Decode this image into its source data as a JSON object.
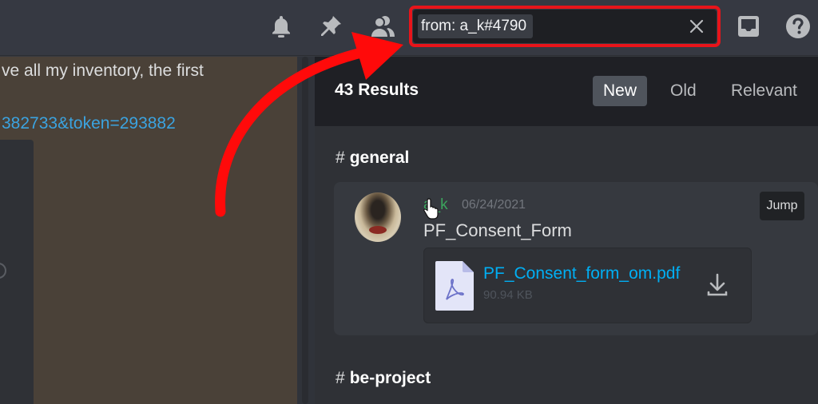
{
  "header": {
    "icons": [
      "bell-icon",
      "pin-icon",
      "members-icon",
      "inbox-icon",
      "help-icon"
    ],
    "search": {
      "query_token": "from: a_k#4790",
      "highlight_color": "#e8141a"
    }
  },
  "chat": {
    "message_text": "ve all my inventory, the first",
    "link_text": "382733&token=293882"
  },
  "results": {
    "count_label": "43 Results",
    "sort_tabs": [
      {
        "label": "New",
        "active": true
      },
      {
        "label": "Old",
        "active": false
      },
      {
        "label": "Relevant",
        "active": false
      }
    ],
    "groups": [
      {
        "channel": "general",
        "message": {
          "author": "a_k",
          "author_visible": ".k",
          "timestamp": "06/24/2021",
          "text": "PF_Consent_Form",
          "jump_label": "Jump",
          "attachment": {
            "filename": "PF_Consent_form_om.pdf",
            "size": "90.94 KB",
            "type_icon": "pdf-file-icon"
          }
        }
      },
      {
        "channel": "be-project"
      }
    ],
    "hash_symbol": "#"
  },
  "colors": {
    "annotation_red": "#e8141a",
    "author_green": "#3ba55d",
    "link_blue": "#00aff4"
  }
}
